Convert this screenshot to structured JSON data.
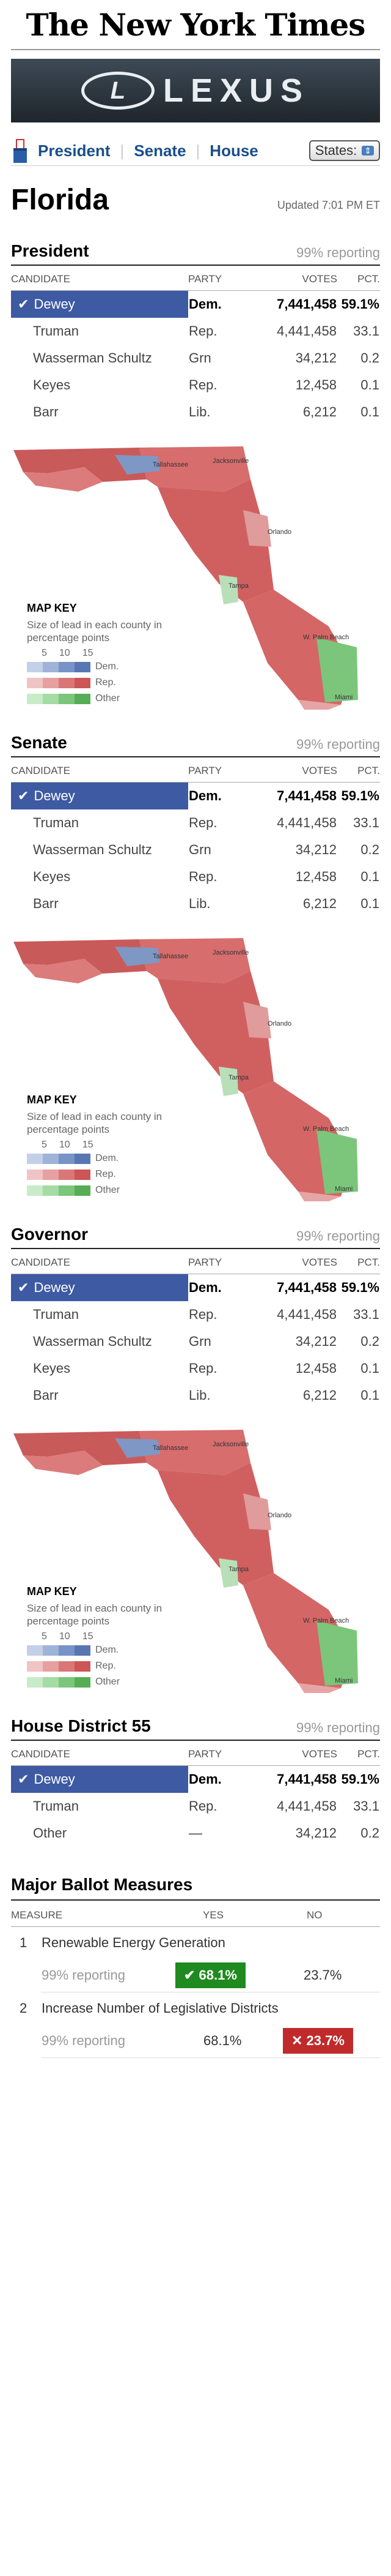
{
  "masthead": "The New York Times",
  "ad": {
    "brand": "LEXUS",
    "emblem": "L"
  },
  "nav": {
    "links": [
      "President",
      "Senate",
      "House"
    ],
    "states_label": "States:"
  },
  "state": "Florida",
  "updated": "Updated 7:01 PM ET",
  "columns": {
    "candidate": "CANDIDATE",
    "party": "PARTY",
    "votes": "VOTES",
    "pct": "PCT."
  },
  "races": [
    {
      "title": "President",
      "reporting": "99% reporting",
      "rows": [
        {
          "name": "Dewey",
          "party": "Dem.",
          "votes": "7,441,458",
          "pct": "59.1%",
          "winner": true
        },
        {
          "name": "Truman",
          "party": "Rep.",
          "votes": "4,441,458",
          "pct": "33.1"
        },
        {
          "name": "Wasserman Schultz",
          "party": "Grn",
          "votes": "34,212",
          "pct": "0.2"
        },
        {
          "name": "Keyes",
          "party": "Rep.",
          "votes": "12,458",
          "pct": "0.1"
        },
        {
          "name": "Barr",
          "party": "Lib.",
          "votes": "6,212",
          "pct": "0.1"
        }
      ]
    },
    {
      "title": "Senate",
      "reporting": "99% reporting",
      "rows": [
        {
          "name": "Dewey",
          "party": "Dem.",
          "votes": "7,441,458",
          "pct": "59.1%",
          "winner": true
        },
        {
          "name": "Truman",
          "party": "Rep.",
          "votes": "4,441,458",
          "pct": "33.1"
        },
        {
          "name": "Wasserman Schultz",
          "party": "Grn",
          "votes": "34,212",
          "pct": "0.2"
        },
        {
          "name": "Keyes",
          "party": "Rep.",
          "votes": "12,458",
          "pct": "0.1"
        },
        {
          "name": "Barr",
          "party": "Lib.",
          "votes": "6,212",
          "pct": "0.1"
        }
      ]
    },
    {
      "title": "Governor",
      "reporting": "99% reporting",
      "rows": [
        {
          "name": "Dewey",
          "party": "Dem.",
          "votes": "7,441,458",
          "pct": "59.1%",
          "winner": true
        },
        {
          "name": "Truman",
          "party": "Rep.",
          "votes": "4,441,458",
          "pct": "33.1"
        },
        {
          "name": "Wasserman Schultz",
          "party": "Grn",
          "votes": "34,212",
          "pct": "0.2"
        },
        {
          "name": "Keyes",
          "party": "Rep.",
          "votes": "12,458",
          "pct": "0.1"
        },
        {
          "name": "Barr",
          "party": "Lib.",
          "votes": "6,212",
          "pct": "0.1"
        }
      ]
    }
  ],
  "map_key": {
    "title": "MAP KEY",
    "desc": "Size of lead in each county in percentage points",
    "ticks": [
      "5",
      "10",
      "15"
    ],
    "rows": [
      "Dem.",
      "Rep.",
      "Other"
    ]
  },
  "map_cities": [
    "Tallahassee",
    "Jacksonville",
    "Orlando",
    "Tampa",
    "W. Palm Beach",
    "Miami"
  ],
  "house": {
    "title": "House District 55",
    "reporting": "99% reporting",
    "rows": [
      {
        "name": "Dewey",
        "party": "Dem.",
        "votes": "7,441,458",
        "pct": "59.1%",
        "winner": true
      },
      {
        "name": "Truman",
        "party": "Rep.",
        "votes": "4,441,458",
        "pct": "33.1"
      },
      {
        "name": "Other",
        "party": "—",
        "votes": "34,212",
        "pct": "0.2"
      }
    ]
  },
  "measures": {
    "title": "Major Ballot Measures",
    "cols": {
      "measure": "MEASURE",
      "yes": "YES",
      "no": "NO"
    },
    "items": [
      {
        "num": "1",
        "name": "Renewable Energy Generation",
        "reporting": "99% reporting",
        "yes": "68.1%",
        "no": "23.7%",
        "result": "yes"
      },
      {
        "num": "2",
        "name": "Increase Number of Legislative Districts",
        "reporting": "99% reporting",
        "yes": "68.1%",
        "no": "23.7%",
        "result": "no"
      }
    ]
  },
  "colors": {
    "dem": "#3d5aa3",
    "rep": "#d06060",
    "other": "#7bc67b",
    "yes": "#1f8a1f",
    "no": "#c02a2a"
  }
}
